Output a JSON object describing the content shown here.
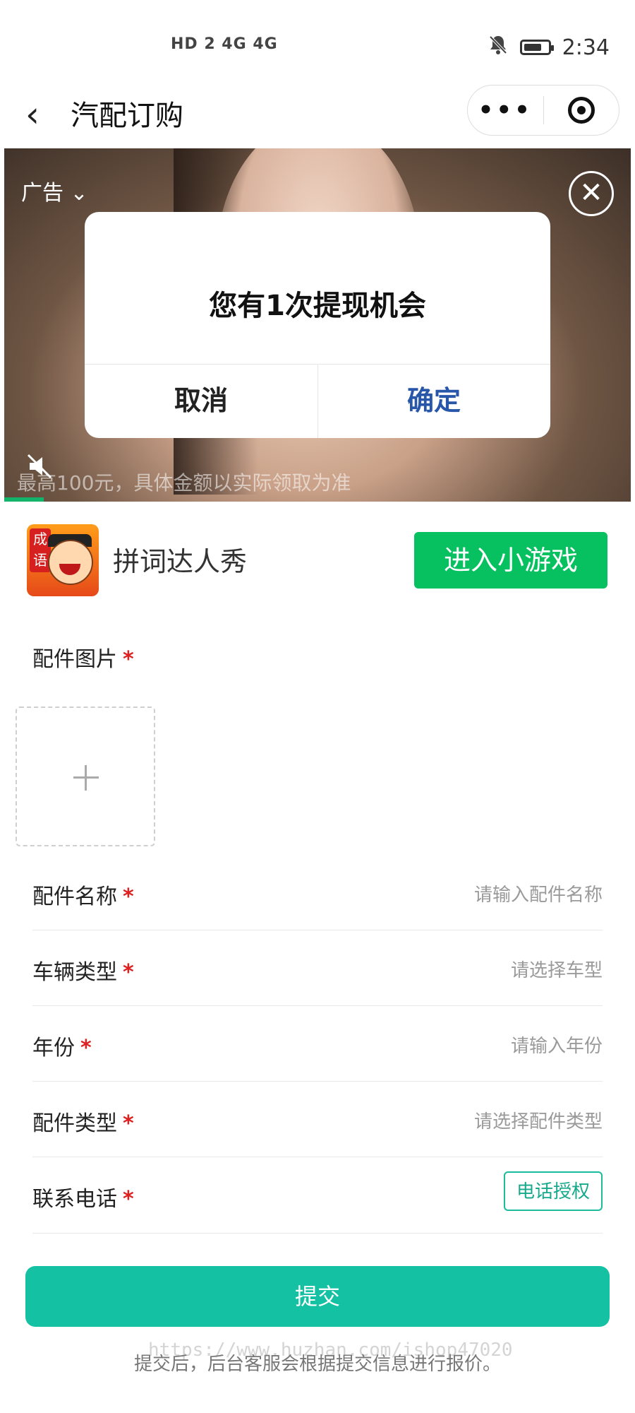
{
  "status_bar": {
    "network": "HD 2  4G  4G",
    "time": "2:34",
    "battery_level": 0.75
  },
  "nav": {
    "title": "汽配订购",
    "back_icon": "chevron-left-icon",
    "more_icon": "more-dots-icon",
    "close_icon": "target-circle-icon"
  },
  "ad": {
    "label": "广告",
    "label_chevron": "⌄",
    "caption": "最高100元，具体金额以实际领取为准",
    "close_symbol": "✕",
    "mute_icon": "speaker-muted-icon"
  },
  "dialog": {
    "message": "您有1次提现机会",
    "cancel_label": "取消",
    "confirm_label": "确定",
    "confirm_color": "#2856a8"
  },
  "game_bar": {
    "icon_badge": "成语",
    "name": "拼词达人秀",
    "button_label": "进入小游戏",
    "button_color": "#07c160"
  },
  "form": {
    "photo_label": "配件图片",
    "required_mark": "*",
    "upload_icon": "plus-icon",
    "fields": [
      {
        "label": "配件名称",
        "placeholder": "请输入配件名称"
      },
      {
        "label": "车辆类型",
        "placeholder": "请选择车型"
      },
      {
        "label": "年份",
        "placeholder": "请输入年份"
      },
      {
        "label": "配件类型",
        "placeholder": "请选择配件类型"
      },
      {
        "label": "联系电话",
        "button": "电话授权"
      }
    ],
    "submit_label": "提交",
    "submit_color": "#14c1a2",
    "footnote": "提交后，后台客服会根据提交信息进行报价。",
    "watermark": "https://www.huzhan.com/ishop47020"
  }
}
